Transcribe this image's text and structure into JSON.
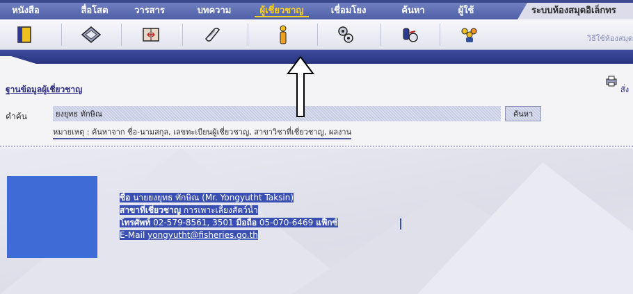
{
  "nav": {
    "tabs": [
      {
        "label": "หนังสือ"
      },
      {
        "label": "สื่อโสต"
      },
      {
        "label": "วารสาร"
      },
      {
        "label": "บทความ"
      },
      {
        "label": "ผู้เชี่ยวชาญ",
        "active": true
      },
      {
        "label": "เชื่อมโยง"
      },
      {
        "label": "ค้นหา"
      },
      {
        "label": "ผู้ใช้"
      }
    ],
    "system_title": "ระบบห้องสมุดอิเล็กทร"
  },
  "toolbar": {
    "icons": [
      "book-icon",
      "diskette-icon",
      "book-open-icon",
      "scroll-icon",
      "expert-person-icon",
      "link-gears-icon",
      "search-binoculars-icon",
      "users-group-icon"
    ],
    "usage_link": "วิธีใช้ห้องสมุด"
  },
  "page": {
    "section_title": "ฐานข้อมูลผู้เชี่ยวชาญ",
    "print_label": "สั่ง"
  },
  "search": {
    "label": "คำค้น",
    "value": "ยงยุทธ ทักษิณ",
    "button_label": "ค้นหา",
    "note": "หมายเหตุ : ค้นหาจาก ชื่อ-นามสกุล, เลขทะเบียนผู้เชี่ยวชาญ, สาขาวิชาที่เชี่ยวชาญ, ผลงาน"
  },
  "expert": {
    "name_label": "ชื่อ",
    "name": "นายยงยุทธ ทักษิณ (Mr. Yongyutht Taksin)",
    "field_label": "สาขาที่เชี่ยวชาญ",
    "field": "การเพาะเลี้ยงสัตว์น้ำ",
    "phone_label": "โทรศัพท์",
    "phone": "02-579-8561, 3501",
    "mobile_label": "มือถือ",
    "mobile": "05-070-6469",
    "fax_label": "แฟ็กซ์",
    "email_label": "E-Mail",
    "email": "yongyutht@fisheries.go.th"
  },
  "colors": {
    "nav_bg": "#5565ad",
    "active_tab": "#ffd21a",
    "highlight": "#3a4fb2",
    "photo": "#3d6cd6"
  }
}
